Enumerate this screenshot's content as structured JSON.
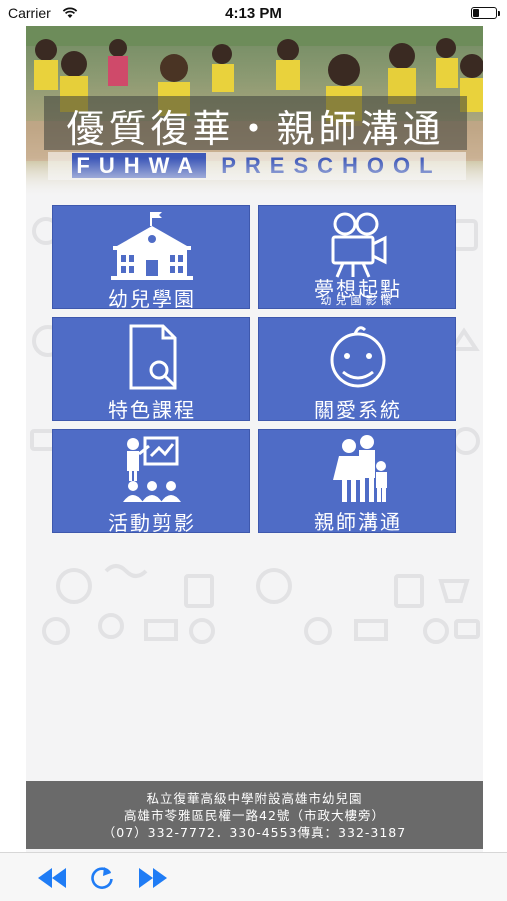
{
  "status_bar": {
    "carrier": "Carrier",
    "time": "4:13 PM"
  },
  "banner": {
    "title_zh": "優質復華‧親師溝通",
    "title_en_part1": "FUHWA",
    "title_en_part2": "PRESCHOOL"
  },
  "menu": {
    "items": [
      {
        "label": "幼兒學園",
        "icon": "school-building-icon"
      },
      {
        "label": "夢想起點",
        "sublabel": "幼兒園影像",
        "icon": "video-camera-icon"
      },
      {
        "label": "特色課程",
        "icon": "document-search-icon"
      },
      {
        "label": "關愛系統",
        "icon": "baby-face-icon"
      },
      {
        "label": "活動剪影",
        "icon": "presentation-teacher-icon"
      },
      {
        "label": "親師溝通",
        "icon": "parent-child-icon"
      }
    ]
  },
  "footer": {
    "line1": "私立復華高級中學附設高雄市幼兒園",
    "line2": "高雄市苓雅區民權一路42號（市政大樓旁）",
    "line3": "（07）332-7772．330-4553傳真：332-3187"
  },
  "toolbar": {
    "accent": "#1f7cf5"
  },
  "colors": {
    "tile": "#4f6cc6",
    "footer": "#6a6a6a"
  }
}
